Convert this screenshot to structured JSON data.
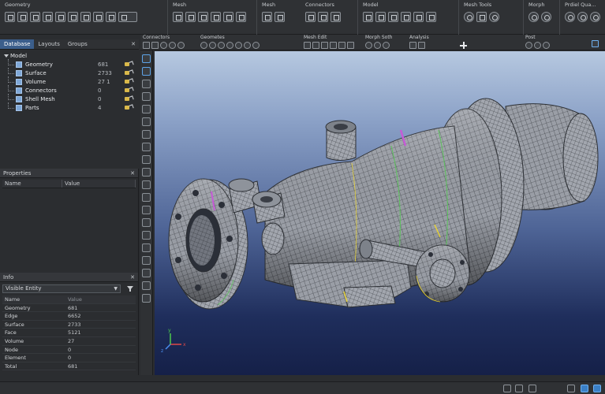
{
  "ribbon": {
    "groups": [
      {
        "title": "Geometry",
        "icons": 11
      },
      {
        "title": "Mesh",
        "icons": 3
      },
      {
        "title": "Mesh",
        "icons": 3
      },
      {
        "title": "Connectors",
        "icons": 5
      },
      {
        "title": "Model",
        "icons": 5
      },
      {
        "title": "Mesh Tools",
        "icons": 3
      },
      {
        "title": "Morph",
        "icons": 2
      },
      {
        "title": "Prdiel Qua...",
        "icons": 3
      }
    ]
  },
  "left_panel": {
    "tabs": [
      {
        "label": "Database",
        "active": true
      },
      {
        "label": "Layouts",
        "active": false
      },
      {
        "label": "Groups",
        "active": false
      }
    ],
    "close_glyph": "✕",
    "tree": {
      "root": "Model",
      "items": [
        {
          "name": "Geometry",
          "count": "681"
        },
        {
          "name": "Surface",
          "count": "2733"
        },
        {
          "name": "Volume",
          "count": "27 1"
        },
        {
          "name": "Connectors",
          "count": "0"
        },
        {
          "name": "Shell Mesh",
          "count": "0"
        },
        {
          "name": "Parts",
          "count": "4"
        }
      ]
    }
  },
  "properties": {
    "title": "Properties",
    "columns": [
      "Name",
      "Value"
    ]
  },
  "info": {
    "title": "Info",
    "selected": "Visible Entity",
    "columns": [
      "Name",
      "Value"
    ],
    "rows": [
      {
        "name": "Geometry",
        "value": "681"
      },
      {
        "name": "Edge",
        "value": "6652"
      },
      {
        "name": "Surface",
        "value": "2733"
      },
      {
        "name": "Face",
        "value": "5121"
      },
      {
        "name": "Volume",
        "value": "27"
      },
      {
        "name": "Node",
        "value": "0"
      },
      {
        "name": "Element",
        "value": "0"
      },
      {
        "name": "Total",
        "value": "681"
      }
    ]
  },
  "viewport_toolbar": {
    "groups": [
      {
        "title": "Connectors",
        "icons": 5
      },
      {
        "title": "Geometes",
        "icons": 7
      },
      {
        "title": "Mesh Edit",
        "icons": 6
      },
      {
        "title": "Morph Soth",
        "icons": 3
      },
      {
        "title": "Analysis",
        "icons": 2
      },
      {
        "title": "Post",
        "icons": 3
      }
    ]
  },
  "colors": {
    "mesh_fill": "#9a9ea6",
    "mesh_lines": "#2c2f34",
    "accent_yellow": "#e6d23a",
    "accent_green": "#5cc25c",
    "accent_magenta": "#c65bd6",
    "selected_tab": "#3b5e8b"
  }
}
